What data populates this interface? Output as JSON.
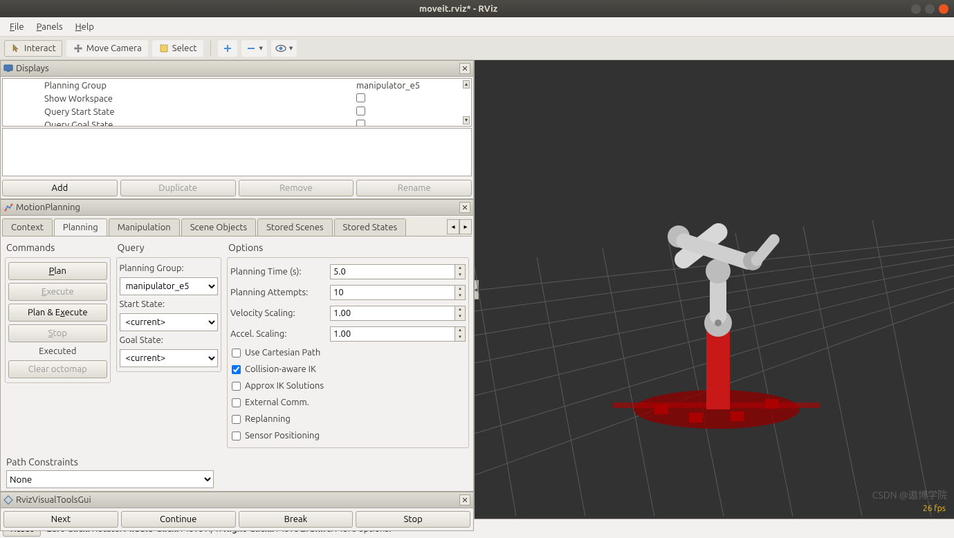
{
  "window": {
    "title": "moveit.rviz* - RViz"
  },
  "menu": {
    "file": "File",
    "panels": "Panels",
    "help": "Help"
  },
  "toolbar": {
    "interact": "Interact",
    "move_camera": "Move Camera",
    "select": "Select"
  },
  "displays": {
    "title": "Displays",
    "rows": [
      {
        "label": "Planning Group",
        "value": "manipulator_e5"
      },
      {
        "label": "Show Workspace",
        "checkbox": true,
        "checked": false
      },
      {
        "label": "Query Start State",
        "checkbox": true,
        "checked": false
      },
      {
        "label": "Query Goal State",
        "checkbox": true,
        "checked": false
      }
    ],
    "btn_add": "Add",
    "btn_duplicate": "Duplicate",
    "btn_remove": "Remove",
    "btn_rename": "Rename"
  },
  "motion_planning": {
    "title": "MotionPlanning",
    "tabs": [
      "Context",
      "Planning",
      "Manipulation",
      "Scene Objects",
      "Stored Scenes",
      "Stored States"
    ],
    "active_tab": 1,
    "commands": {
      "title": "Commands",
      "plan": "Plan",
      "execute": "Execute",
      "plan_execute": "Plan & Execute",
      "stop": "Stop",
      "executed": "Executed",
      "clear_octomap": "Clear octomap"
    },
    "query": {
      "title": "Query",
      "planning_group_label": "Planning Group:",
      "planning_group": "manipulator_e5",
      "start_state_label": "Start State:",
      "start_state": "<current>",
      "goal_state_label": "Goal State:",
      "goal_state": "<current>"
    },
    "options": {
      "title": "Options",
      "planning_time_label": "Planning Time (s):",
      "planning_time": "5.0",
      "planning_attempts_label": "Planning Attempts:",
      "planning_attempts": "10",
      "velocity_scaling_label": "Velocity Scaling:",
      "velocity_scaling": "1.00",
      "accel_scaling_label": "Accel. Scaling:",
      "accel_scaling": "1.00",
      "use_cartesian": "Use Cartesian Path",
      "collision_ik": "Collision-aware IK",
      "approx_ik": "Approx IK Solutions",
      "external_comm": "External Comm.",
      "replanning": "Replanning",
      "sensor_positioning": "Sensor Positioning"
    },
    "path_constraints": {
      "title": "Path Constraints",
      "value": "None"
    }
  },
  "visual_tools": {
    "title": "RvizVisualToolsGui",
    "next": "Next",
    "continue": "Continue",
    "break": "Break",
    "stop": "Stop"
  },
  "statusbar": {
    "reset": "Reset",
    "left_click_b": "Left-Click:",
    "left_click": " Rotate. ",
    "middle_click_b": "Middle-Click:",
    "middle_click": " Move X/Y. ",
    "right_click_b": "Right-Click::",
    "right_click": " Move Z. ",
    "shift_b": "Shift",
    "shift": ": More options.",
    "fps": "26 fps"
  },
  "watermark": "CSDN @遨博学院"
}
